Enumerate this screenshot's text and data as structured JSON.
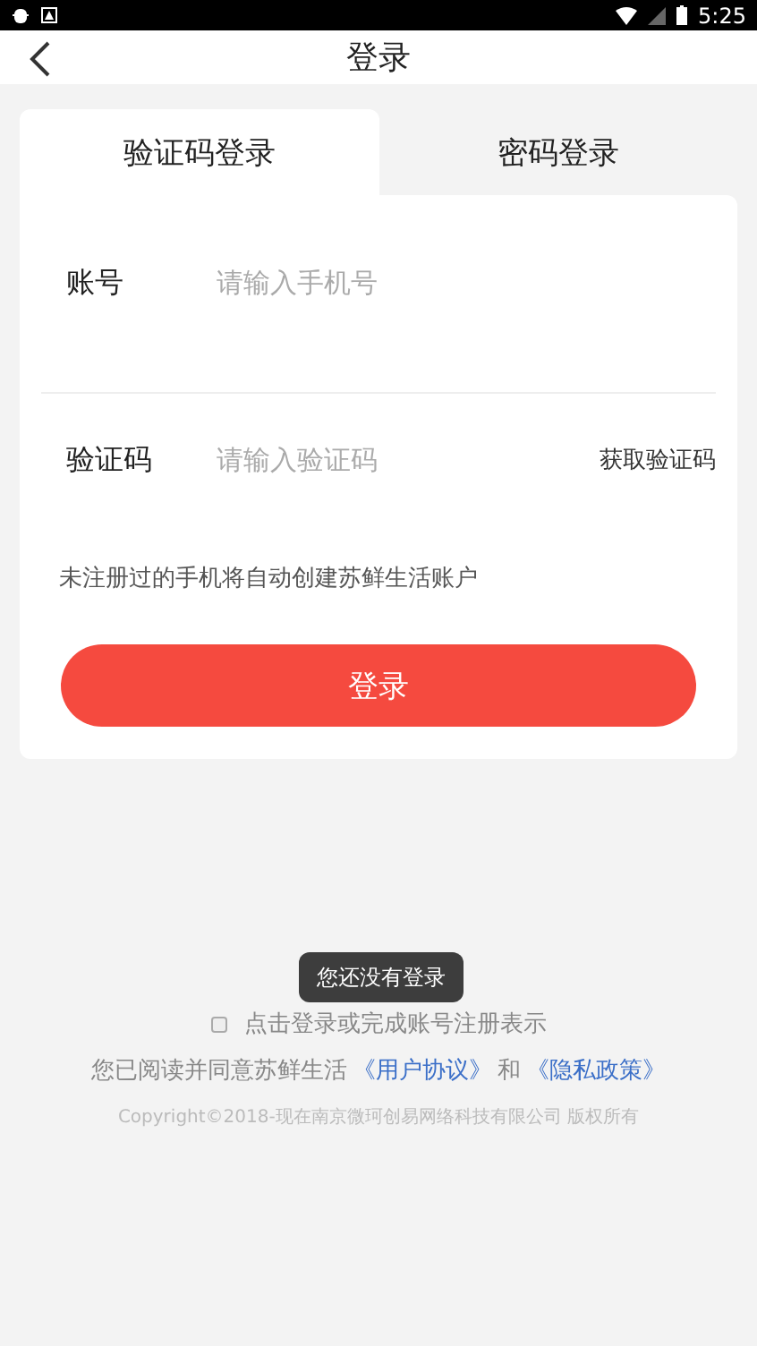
{
  "status_bar": {
    "time": "5:25"
  },
  "header": {
    "title": "登录"
  },
  "tabs": [
    {
      "label": "验证码登录",
      "selected": true
    },
    {
      "label": "密码登录",
      "selected": false
    }
  ],
  "form": {
    "fields": [
      {
        "label": "账号",
        "placeholder": "请输入手机号"
      },
      {
        "label": "验证码",
        "placeholder": "请输入验证码",
        "action": "获取验证码"
      }
    ],
    "hint": "未注册过的手机将自动创建苏鲜生活账户",
    "submit": "登录"
  },
  "toast": "您还没有登录",
  "agreement": {
    "checked": false,
    "text": "点击登录或完成账号注册表示",
    "line": "您已阅读并同意苏鲜生活",
    "links": [
      "《用户协议》",
      "《隐私政策》"
    ],
    "joiner": "和"
  },
  "copyright": "Copyright©2018-现在南京微珂创易网络科技有限公司 版权所有"
}
